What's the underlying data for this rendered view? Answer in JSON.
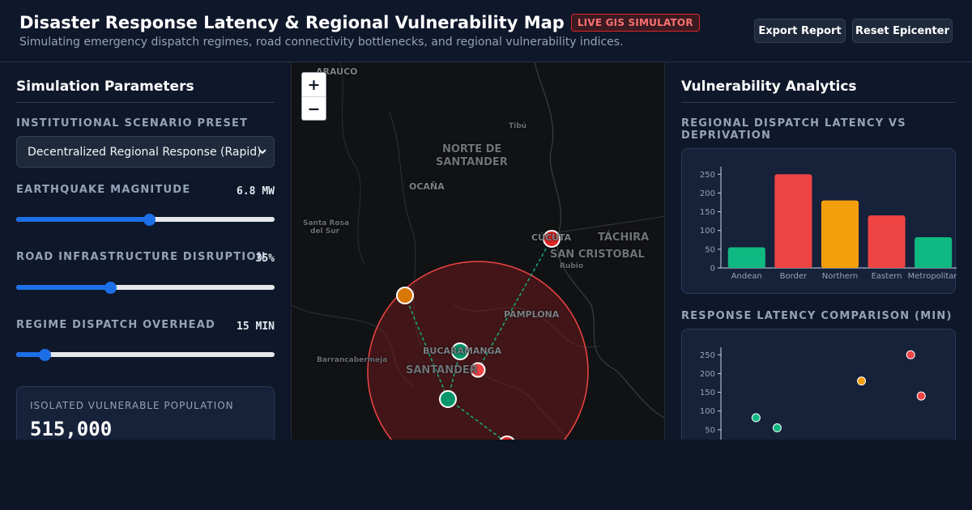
{
  "header": {
    "title": "Disaster Response Latency & Regional Vulnerability Map",
    "badge": "LIVE GIS SIMULATOR",
    "subtitle": "Simulating emergency dispatch regimes, road connectivity bottlenecks, and regional vulnerability indices.",
    "export_label": "Export Report",
    "reset_label": "Reset Epicenter"
  },
  "params": {
    "title": "Simulation Parameters",
    "preset_label": "Institutional Scenario Preset",
    "preset_value": "Decentralized Regional Response (Rapid)",
    "magnitude_label": "Earthquake Magnitude",
    "magnitude_value": "6.8 MW",
    "magnitude_fraction": 0.515,
    "disruption_label": "Road Infrastructure Disruption",
    "disruption_value": "35%",
    "disruption_fraction": 0.365,
    "overhead_label": "Regime Dispatch Overhead",
    "overhead_value": "15 MIN",
    "overhead_fraction": 0.11,
    "stat_label": "Isolated Vulnerable Population",
    "stat_value": "515,000"
  },
  "map": {
    "zoom_in": "+",
    "zoom_out": "−",
    "places": {
      "arauca": "ARAUCO",
      "tibu": "Tibú",
      "norte1": "NORTE DE",
      "norte2": "SANTANDER",
      "ocana": "OCAÑA",
      "santa_rosa1": "Santa Rosa",
      "santa_rosa2": "del Sur",
      "cucuta": "CÚCUTA",
      "tachira": "TÁCHIRA",
      "san_cristobal": "SAN CRISTOBAL",
      "rubio": "Rubio",
      "pamplona": "PAMPLONA",
      "bucaramanga": "BUCARAMANGA",
      "santander": "SANTANDER",
      "barranca": "Barrancabermeja"
    }
  },
  "analytics": {
    "title": "Vulnerability Analytics",
    "chart1_label": "Regional Dispatch Latency vs Deprivation",
    "chart2_label": "Response Latency Comparison (Min)"
  },
  "colors": {
    "low": "#10b981",
    "mid": "#f59e0b",
    "high": "#ef4444",
    "accent": "#1d6fe8"
  },
  "chart_data": [
    {
      "type": "bar",
      "categories": [
        "Andean",
        "Border",
        "Northern",
        "Eastern",
        "Metropolitan"
      ],
      "values": [
        55,
        250,
        180,
        140,
        82
      ],
      "bar_colors": [
        "#10b981",
        "#ef4444",
        "#f59e0b",
        "#ef4444",
        "#10b981"
      ],
      "yticks": [
        0,
        50,
        100,
        150,
        200,
        250
      ],
      "ylim": [
        0,
        270
      ]
    },
    {
      "type": "scatter",
      "points": [
        {
          "x": 1.0,
          "y": 82,
          "color": "#10b981"
        },
        {
          "x": 1.6,
          "y": 55,
          "color": "#10b981"
        },
        {
          "x": 4.0,
          "y": 180,
          "color": "#f59e0b"
        },
        {
          "x": 5.4,
          "y": 250,
          "color": "#ef4444"
        },
        {
          "x": 5.7,
          "y": 140,
          "color": "#ef4444"
        }
      ],
      "yticks": [
        50,
        100,
        150,
        200,
        250
      ],
      "xlim": [
        0,
        6.5
      ],
      "ylim": [
        0,
        270
      ]
    }
  ]
}
